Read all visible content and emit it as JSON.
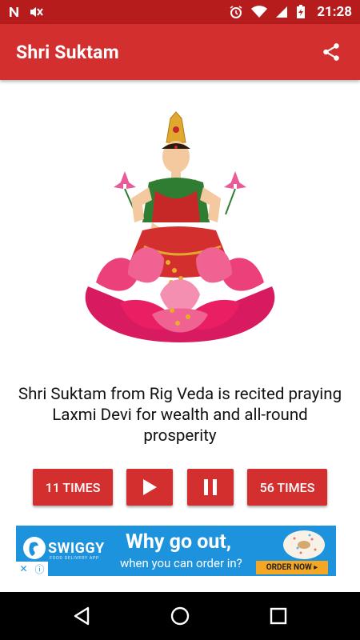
{
  "status_bar": {
    "time": "21:28",
    "icons": [
      "n-notification-icon",
      "mute-icon",
      "alarm-icon",
      "wifi-icon",
      "signal-icon",
      "battery-charging-icon"
    ]
  },
  "app_bar": {
    "title": "Shri Suktam",
    "share_icon": "share-icon"
  },
  "hero": {
    "image_subject": "Goddess Laxmi seated on pink lotus"
  },
  "description": "Shri Suktam from Rig Veda is recited praying Laxmi Devi for wealth and all-round prosperity",
  "controls": {
    "count_left_label": "11 TIMES",
    "play_icon": "play-icon",
    "pause_icon": "pause-icon",
    "count_right_label": "56 TIMES"
  },
  "ad": {
    "brand": "SWIGGY",
    "tagline": "FOOD DELIVERY APP",
    "headline": "Why go out,",
    "subline": "when you can order in?",
    "cta": "ORDER NOW ▸",
    "ad_choices_close": "✕",
    "ad_choices_info": "ⓘ"
  },
  "nav": {
    "back_icon": "back-icon",
    "home_icon": "home-icon",
    "recents_icon": "recents-icon"
  },
  "colors": {
    "primary": "#d32f2f",
    "primary_dark": "#b71c1c",
    "ad_blue": "#1e93dd",
    "ad_cta": "#f5a623"
  }
}
